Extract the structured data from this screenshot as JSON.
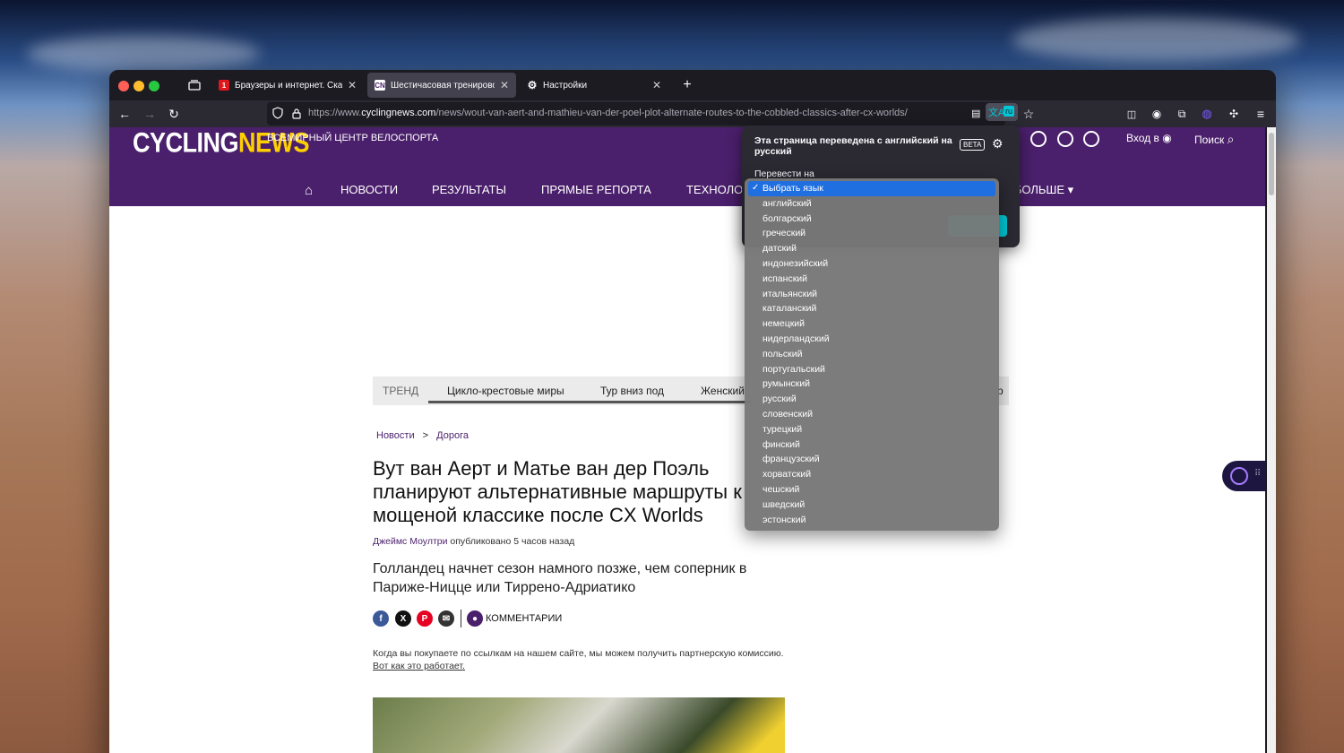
{
  "tabs": [
    {
      "label": "Браузеры и интернет. Скачать",
      "favicon": "1",
      "active": false
    },
    {
      "label": "Шестичасовая тренировочная",
      "favicon": "CN",
      "active": true
    },
    {
      "label": "Настройки",
      "favicon": "gear",
      "active": false
    }
  ],
  "url": {
    "prefix": "https://www.",
    "domain": "cyclingnews.com",
    "path": "/news/wout-van-aert-and-mathieu-van-der-poel-plot-alternate-routes-to-the-cobbled-classics-after-cx-worlds/"
  },
  "translate_button": {
    "label": "ru"
  },
  "site": {
    "logo_part1": "CYCLING",
    "logo_part2": "NEWS",
    "tagline": "ВСЕМИРНЫЙ ЦЕНТР ВЕЛОСПОРТА",
    "login": "Вход в",
    "search": "Поиск",
    "nav": [
      "НОВОСТИ",
      "РЕЗУЛЬТАТЫ",
      "ПРЯМЫЕ РЕПОРТА",
      "ТЕХНОЛО",
      "БОЛЬШЕ ▾"
    ]
  },
  "trending": {
    "label": "ТРЕНД",
    "items": [
      "Цикло-крестовые миры",
      "Тур вниз под",
      "Женский"
    ],
    "tail": "р"
  },
  "breadcrumb": {
    "items": [
      "Новости",
      "Дорога"
    ],
    "separator": ">"
  },
  "article": {
    "headline": "Вут ван Аерт и Матье ван дер Поэль планируют альтернативные маршруты к мощеной классике после CX Worlds",
    "author": "Джеймс Моултри",
    "published": "опубликовано 5 часов назад",
    "subhead": "Голландец начнет сезон намного позже, чем соперник в Париже-Ницце или Тиррено-Адриатико",
    "comments_label": "КОММЕНТАРИИ",
    "affiliate_text": "Когда вы покупаете по ссылкам на нашем сайте, мы можем получить партнерскую комиссию.",
    "affiliate_link": "Вот как это работает."
  },
  "translation_popup": {
    "title": "Эта страница переведена с английский на русский",
    "badge": "BETA",
    "translate_to_label": "Перевести на"
  },
  "language_dropdown": {
    "selected": "Выбрать язык",
    "options": [
      "английский",
      "болгарский",
      "греческий",
      "датский",
      "индонезийский",
      "испанский",
      "итальянский",
      "каталанский",
      "немецкий",
      "нидерландский",
      "польский",
      "португальский",
      "румынский",
      "русский",
      "словенский",
      "турецкий",
      "финский",
      "французский",
      "хорватский",
      "чешский",
      "шведский",
      "эстонский"
    ]
  },
  "colors": {
    "brand_purple": "#4a1f6b",
    "brand_yellow": "#ffd000",
    "dropdown_highlight": "#1f6fe0",
    "firefox_accent": "#00c8d7"
  }
}
